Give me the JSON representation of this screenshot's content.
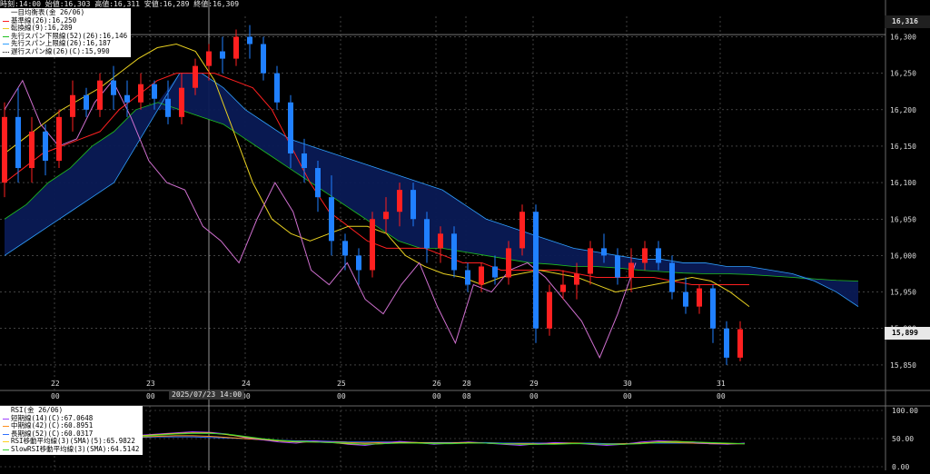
{
  "header": {
    "text": "時刻:14:00 始値:16,303 高値:16,311 安値:16,289 終値:16,309"
  },
  "legend_main": {
    "title": "一目均衡表(金 26/06)",
    "items": [
      {
        "label": "基準線(26):16,250",
        "color": "#ff2020",
        "style": "solid"
      },
      {
        "label": "転換線(9):16,289",
        "color": "#e8d020",
        "style": "solid"
      },
      {
        "label": "先行スパン下限線(52)(26):16,146",
        "color": "#20c020",
        "style": "solid"
      },
      {
        "label": "先行スパン上限線(26):16,187",
        "color": "#30a0ff",
        "style": "solid"
      },
      {
        "label": "遅行スパン線(26)(C):15,990",
        "color": "#000000",
        "style": "dotted"
      }
    ]
  },
  "legend_rsi": {
    "title": "RSI(金 26/06)",
    "items": [
      {
        "label": "短期線(14)(C):67.0648",
        "color": "#a040ff"
      },
      {
        "label": "中期線(42)(C):60.8951",
        "color": "#ff9020"
      },
      {
        "label": "長期線(52)(C):60.0317",
        "color": "#3070ff"
      },
      {
        "label": "RSI移動平均線(3)(SMA)(5):65.9822",
        "color": "#ffd020"
      },
      {
        "label": "SlowRSI移動平均線(3)(SMA):64.5142",
        "color": "#30d030"
      }
    ]
  },
  "price_axis": {
    "ticks": [
      "16,300",
      "16,250",
      "16,200",
      "16,150",
      "16,100",
      "16,050",
      "16,000",
      "15,950",
      "15,900",
      "15,850"
    ],
    "top_label": "16,316",
    "last_price": "15,899"
  },
  "rsi_axis": {
    "ticks": [
      "100.00",
      "50.00",
      "0.00"
    ]
  },
  "time_axis": {
    "days": [
      {
        "label": "22",
        "sub": "00"
      },
      {
        "label": "23",
        "sub": "00"
      },
      {
        "label": "24",
        "sub": "00"
      },
      {
        "label": "25",
        "sub": "00"
      },
      {
        "label": "26",
        "sub": "00"
      },
      {
        "label": "28",
        "sub": "08"
      },
      {
        "label": "29",
        "sub": "00"
      },
      {
        "label": "30",
        "sub": "00"
      },
      {
        "label": "31",
        "sub": "00"
      }
    ],
    "cursor_label": "2025/07/23 14:00"
  },
  "colors": {
    "background": "#000000",
    "grid": "#6a6a6a",
    "up_candle": "#ff2020",
    "down_candle": "#2080ff",
    "kijun": "#ff2020",
    "tenkan": "#e8d020",
    "span_a": "#20c020",
    "span_b": "#30a0ff",
    "chikou": "#d070d0",
    "cloud": "#0a1a55"
  },
  "chart_data": {
    "type": "candlestick",
    "title": "一目均衡表(金 26/06)",
    "ylim": [
      15815,
      16328
    ],
    "rsi_ylim": [
      0,
      100
    ],
    "x_labels": [
      "22",
      "23",
      "24",
      "25",
      "26",
      "28",
      "29",
      "30",
      "31"
    ],
    "candles": [
      {
        "o": 16100,
        "h": 16210,
        "l": 16080,
        "c": 16190
      },
      {
        "o": 16190,
        "h": 16230,
        "l": 16100,
        "c": 16120
      },
      {
        "o": 16120,
        "h": 16190,
        "l": 16100,
        "c": 16170
      },
      {
        "o": 16170,
        "h": 16180,
        "l": 16110,
        "c": 16130
      },
      {
        "o": 16130,
        "h": 16200,
        "l": 16120,
        "c": 16190
      },
      {
        "o": 16190,
        "h": 16240,
        "l": 16170,
        "c": 16220
      },
      {
        "o": 16220,
        "h": 16230,
        "l": 16190,
        "c": 16200
      },
      {
        "o": 16200,
        "h": 16250,
        "l": 16190,
        "c": 16240
      },
      {
        "o": 16240,
        "h": 16260,
        "l": 16200,
        "c": 16220
      },
      {
        "o": 16220,
        "h": 16240,
        "l": 16190,
        "c": 16210
      },
      {
        "o": 16210,
        "h": 16250,
        "l": 16200,
        "c": 16235
      },
      {
        "o": 16235,
        "h": 16240,
        "l": 16200,
        "c": 16215
      },
      {
        "o": 16215,
        "h": 16240,
        "l": 16180,
        "c": 16190
      },
      {
        "o": 16190,
        "h": 16250,
        "l": 16180,
        "c": 16230
      },
      {
        "o": 16230,
        "h": 16270,
        "l": 16220,
        "c": 16260
      },
      {
        "o": 16260,
        "h": 16290,
        "l": 16240,
        "c": 16280
      },
      {
        "o": 16280,
        "h": 16300,
        "l": 16250,
        "c": 16270
      },
      {
        "o": 16270,
        "h": 16310,
        "l": 16260,
        "c": 16300
      },
      {
        "o": 16300,
        "h": 16316,
        "l": 16270,
        "c": 16290
      },
      {
        "o": 16290,
        "h": 16300,
        "l": 16240,
        "c": 16250
      },
      {
        "o": 16250,
        "h": 16260,
        "l": 16200,
        "c": 16210
      },
      {
        "o": 16210,
        "h": 16220,
        "l": 16120,
        "c": 16140
      },
      {
        "o": 16140,
        "h": 16160,
        "l": 16100,
        "c": 16120
      },
      {
        "o": 16120,
        "h": 16130,
        "l": 16060,
        "c": 16080
      },
      {
        "o": 16080,
        "h": 16110,
        "l": 16000,
        "c": 16020
      },
      {
        "o": 16020,
        "h": 16030,
        "l": 15980,
        "c": 16000
      },
      {
        "o": 16000,
        "h": 16010,
        "l": 15960,
        "c": 15980
      },
      {
        "o": 15980,
        "h": 16060,
        "l": 15970,
        "c": 16050
      },
      {
        "o": 16050,
        "h": 16080,
        "l": 16030,
        "c": 16060
      },
      {
        "o": 16060,
        "h": 16100,
        "l": 16040,
        "c": 16090
      },
      {
        "o": 16090,
        "h": 16100,
        "l": 16040,
        "c": 16050
      },
      {
        "o": 16050,
        "h": 16060,
        "l": 15990,
        "c": 16010
      },
      {
        "o": 16010,
        "h": 16040,
        "l": 15990,
        "c": 16030
      },
      {
        "o": 16030,
        "h": 16040,
        "l": 15970,
        "c": 15980
      },
      {
        "o": 15980,
        "h": 15990,
        "l": 15950,
        "c": 15960
      },
      {
        "o": 15960,
        "h": 15990,
        "l": 15950,
        "c": 15985
      },
      {
        "o": 15985,
        "h": 16000,
        "l": 15960,
        "c": 15970
      },
      {
        "o": 15970,
        "h": 16020,
        "l": 15960,
        "c": 16010
      },
      {
        "o": 16010,
        "h": 16070,
        "l": 16000,
        "c": 16060
      },
      {
        "o": 16060,
        "h": 16070,
        "l": 15880,
        "c": 15900
      },
      {
        "o": 15900,
        "h": 15960,
        "l": 15890,
        "c": 15950
      },
      {
        "o": 15950,
        "h": 15980,
        "l": 15940,
        "c": 15960
      },
      {
        "o": 15960,
        "h": 15990,
        "l": 15940,
        "c": 15975
      },
      {
        "o": 15975,
        "h": 16020,
        "l": 15960,
        "c": 16010
      },
      {
        "o": 16010,
        "h": 16030,
        "l": 15990,
        "c": 16000
      },
      {
        "o": 16000,
        "h": 16010,
        "l": 15960,
        "c": 15970
      },
      {
        "o": 15970,
        "h": 16010,
        "l": 15950,
        "c": 15990
      },
      {
        "o": 15990,
        "h": 16020,
        "l": 15980,
        "c": 16010
      },
      {
        "o": 16010,
        "h": 16020,
        "l": 15980,
        "c": 15990
      },
      {
        "o": 15990,
        "h": 16000,
        "l": 15940,
        "c": 15950
      },
      {
        "o": 15950,
        "h": 15970,
        "l": 15920,
        "c": 15930
      },
      {
        "o": 15930,
        "h": 15960,
        "l": 15920,
        "c": 15955
      },
      {
        "o": 15955,
        "h": 15960,
        "l": 15880,
        "c": 15900
      },
      {
        "o": 15900,
        "h": 15910,
        "l": 15850,
        "c": 15860
      },
      {
        "o": 15860,
        "h": 15910,
        "l": 15855,
        "c": 15899
      }
    ],
    "kijun": [
      16100,
      16120,
      16140,
      16150,
      16160,
      16170,
      16200,
      16220,
      16240,
      16250,
      16250,
      16250,
      16240,
      16230,
      16200,
      16150,
      16100,
      16060,
      16040,
      16020,
      16010,
      16010,
      16010,
      16000,
      15990,
      15990,
      15980,
      15980,
      15980,
      15980,
      15975,
      15970,
      15970,
      15970,
      15970,
      15965,
      15960,
      15960,
      15960,
      15960
    ],
    "tenkan": [
      16140,
      16160,
      16180,
      16200,
      16215,
      16230,
      16250,
      16270,
      16285,
      16290,
      16280,
      16240,
      16170,
      16100,
      16050,
      16030,
      16020,
      16030,
      16040,
      16040,
      16030,
      16000,
      15985,
      15975,
      15970,
      15960,
      15970,
      15975,
      15980,
      15975,
      15970,
      15960,
      15950,
      15955,
      15960,
      15965,
      15970,
      15965,
      15950,
      15930
    ],
    "span_a": [
      16050,
      16070,
      16100,
      16120,
      16150,
      16170,
      16200,
      16210,
      16200,
      16190,
      16180,
      16160,
      16140,
      16120,
      16100,
      16080,
      16060,
      16040,
      16020,
      16010,
      16010,
      16005,
      16000,
      15995,
      15990,
      15988,
      15985,
      15985,
      15983,
      15980,
      15978,
      15976,
      15975,
      15975,
      15974,
      15972,
      15970,
      15968,
      15966,
      15965
    ],
    "span_b": [
      16000,
      16020,
      16040,
      16060,
      16080,
      16100,
      16150,
      16200,
      16250,
      16250,
      16230,
      16200,
      16180,
      16160,
      16150,
      16140,
      16130,
      16120,
      16110,
      16100,
      16090,
      16070,
      16050,
      16040,
      16030,
      16020,
      16010,
      16005,
      16000,
      15995,
      15995,
      15990,
      15990,
      15985,
      15985,
      15980,
      15975,
      15965,
      15950,
      15930
    ],
    "chikou": [
      16200,
      16240,
      16180,
      16150,
      16160,
      16210,
      16240,
      16190,
      16130,
      16100,
      16090,
      16040,
      16020,
      15990,
      16050,
      16100,
      16060,
      15980,
      15960,
      15990,
      15940,
      15920,
      15960,
      15990,
      15930,
      15880,
      15960,
      15950,
      15980,
      15990,
      15970,
      15940,
      15910,
      15860,
      15920,
      15990
    ],
    "rsi": {
      "short": [
        56,
        58,
        60,
        62,
        61,
        58,
        52,
        48,
        44,
        42,
        46,
        44,
        40,
        38,
        42,
        45,
        43,
        40,
        42,
        44,
        42,
        40,
        38,
        41,
        43,
        42,
        40,
        38,
        40,
        44,
        46,
        45,
        43,
        41,
        40,
        42
      ],
      "middle": [
        53,
        54,
        55,
        55,
        54,
        52,
        50,
        48,
        46,
        45,
        45,
        44,
        43,
        42,
        43,
        43,
        42,
        42,
        42,
        43,
        42,
        41,
        41,
        41,
        42,
        42,
        41,
        40,
        41,
        42,
        43,
        43,
        42,
        41,
        41,
        41
      ],
      "long": [
        52,
        53,
        53,
        53,
        52,
        51,
        50,
        48,
        47,
        46,
        46,
        45,
        44,
        44,
        44,
        44,
        43,
        43,
        43,
        43,
        43,
        42,
        42,
        42,
        42,
        42,
        42,
        41,
        41,
        42,
        42,
        42,
        42,
        41,
        41,
        41
      ],
      "ma": [
        55,
        57,
        59,
        60,
        60,
        57,
        53,
        49,
        46,
        44,
        44,
        43,
        41,
        40,
        41,
        43,
        43,
        42,
        42,
        43,
        42,
        41,
        40,
        40,
        41,
        42,
        41,
        40,
        40,
        42,
        44,
        45,
        44,
        42,
        41,
        41
      ],
      "slow": [
        54,
        56,
        58,
        59,
        59,
        58,
        54,
        50,
        47,
        45,
        44,
        43,
        42,
        40,
        41,
        42,
        42,
        41,
        41,
        42,
        42,
        41,
        40,
        40,
        40,
        41,
        41,
        40,
        40,
        41,
        43,
        44,
        44,
        43,
        42,
        41
      ]
    }
  }
}
